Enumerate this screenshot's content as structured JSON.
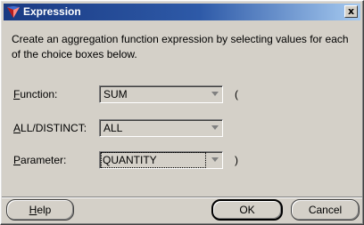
{
  "window": {
    "title": "Expression",
    "close_label": "x"
  },
  "description": "Create an aggregation function expression by selecting values for each of the choice boxes below.",
  "fields": {
    "function": {
      "label_mnemonic": "F",
      "label_rest": "unction:",
      "value": "SUM",
      "suffix": "("
    },
    "all_distinct": {
      "label_mnemonic": "A",
      "label_rest": "LL/DISTINCT:",
      "value": "ALL"
    },
    "parameter": {
      "label_mnemonic": "P",
      "label_rest": "arameter:",
      "value": "QUANTITY",
      "suffix": ")"
    }
  },
  "buttons": {
    "help_mnemonic": "H",
    "help_rest": "elp",
    "ok": "OK",
    "cancel": "Cancel"
  }
}
